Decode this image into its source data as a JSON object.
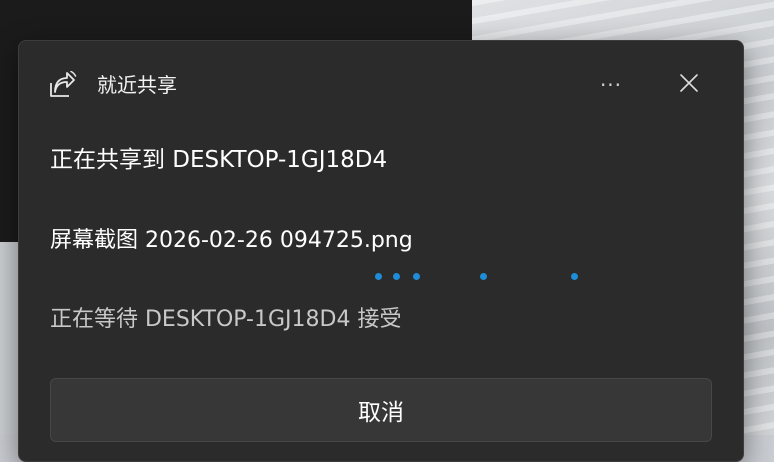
{
  "window": {
    "title": "就近共享",
    "app_icon": "nearby-share-icon",
    "more_icon": "more-icon",
    "more_label": "···",
    "close_icon": "close-icon"
  },
  "share": {
    "heading": "正在共享到 DESKTOP-1GJ18D4",
    "file_name": "屏幕截图 2026-02-26 094725.png",
    "status": "正在等待 DESKTOP-1GJ18D4 接受",
    "progress_style": "indeterminate"
  },
  "actions": {
    "cancel_label": "取消"
  },
  "colors": {
    "accent": "#1e8cd6",
    "dialog_background": "#2b2b2b",
    "button_background": "#373737"
  }
}
